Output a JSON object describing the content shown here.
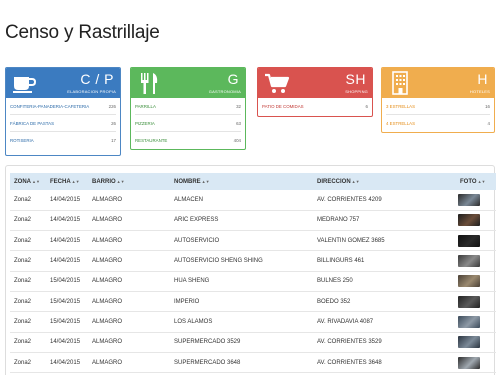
{
  "page": {
    "title": "Censo y Rastrillaje"
  },
  "cards": [
    {
      "id": "elaboracion",
      "icon": "coffee-cup-icon",
      "code": "C / P",
      "category": "ELABORACION PROPIA",
      "color": "#3b7bc0",
      "rows": [
        {
          "label": "CONFITERIA-PANADERIA-CAFETERIA",
          "count": "226"
        },
        {
          "label": "FÁBRICA DE PASTAS",
          "count": "26"
        },
        {
          "label": "ROTISERIA",
          "count": "17"
        }
      ]
    },
    {
      "id": "gastronomia",
      "icon": "fork-knife-icon",
      "code": "G",
      "category": "GASTRONOMIA",
      "color": "#5cb85c",
      "rows": [
        {
          "label": "PARRILLA",
          "count": "32"
        },
        {
          "label": "PIZZERIA",
          "count": "63"
        },
        {
          "label": "RESTAURANTE",
          "count": "404"
        }
      ]
    },
    {
      "id": "shopping",
      "icon": "shopping-cart-icon",
      "code": "SH",
      "category": "SHOPPING",
      "color": "#d9534f",
      "rows": [
        {
          "label": "PATIO DE COMIDAS",
          "count": "6"
        }
      ]
    },
    {
      "id": "hoteles",
      "icon": "building-icon",
      "code": "H",
      "category": "HOTELES",
      "color": "#f0ad4e",
      "rows": [
        {
          "label": "3 ESTRELLAS",
          "count": "16"
        },
        {
          "label": "4 ESTRELLAS",
          "count": "4"
        }
      ]
    }
  ],
  "table": {
    "columns": [
      "ZONA",
      "FECHA",
      "BARRIO",
      "NOMBRE",
      "DIRECCION",
      "FOTO"
    ],
    "sort_glyph": "▲▼",
    "rows": [
      {
        "zona": "Zona2",
        "fecha": "14/04/2015",
        "barrio": "ALMAGRO",
        "nombre": "ALMACEN",
        "direccion": "AV. CORRIENTES 4209"
      },
      {
        "zona": "Zona2",
        "fecha": "14/04/2015",
        "barrio": "ALMAGRO",
        "nombre": "ARIC EXPRESS",
        "direccion": "MEDRANO 757"
      },
      {
        "zona": "Zona2",
        "fecha": "14/04/2015",
        "barrio": "ALMAGRO",
        "nombre": "AUTOSERVICIO",
        "direccion": "VALENTIN GOMEZ 3685"
      },
      {
        "zona": "Zona2",
        "fecha": "14/04/2015",
        "barrio": "ALMAGRO",
        "nombre": "AUTOSERVICIO SHENG SHING",
        "direccion": "BILLINGURS 461"
      },
      {
        "zona": "Zona2",
        "fecha": "15/04/2015",
        "barrio": "ALMAGRO",
        "nombre": "HUA SHENG",
        "direccion": "BULNES 250"
      },
      {
        "zona": "Zona2",
        "fecha": "15/04/2015",
        "barrio": "ALMAGRO",
        "nombre": "IMPERIO",
        "direccion": "BOEDO 352"
      },
      {
        "zona": "Zona2",
        "fecha": "15/04/2015",
        "barrio": "ALMAGRO",
        "nombre": "LOS ALAMOS",
        "direccion": "AV. RIVADAVIA 4087"
      },
      {
        "zona": "Zona2",
        "fecha": "14/04/2015",
        "barrio": "ALMAGRO",
        "nombre": "SUPERMERCADO 3529",
        "direccion": "AV. CORRIENTES 3529"
      },
      {
        "zona": "Zona2",
        "fecha": "14/04/2015",
        "barrio": "ALMAGRO",
        "nombre": "SUPERMERCADO 3648",
        "direccion": "AV. CORRIENTES 3648"
      }
    ]
  }
}
